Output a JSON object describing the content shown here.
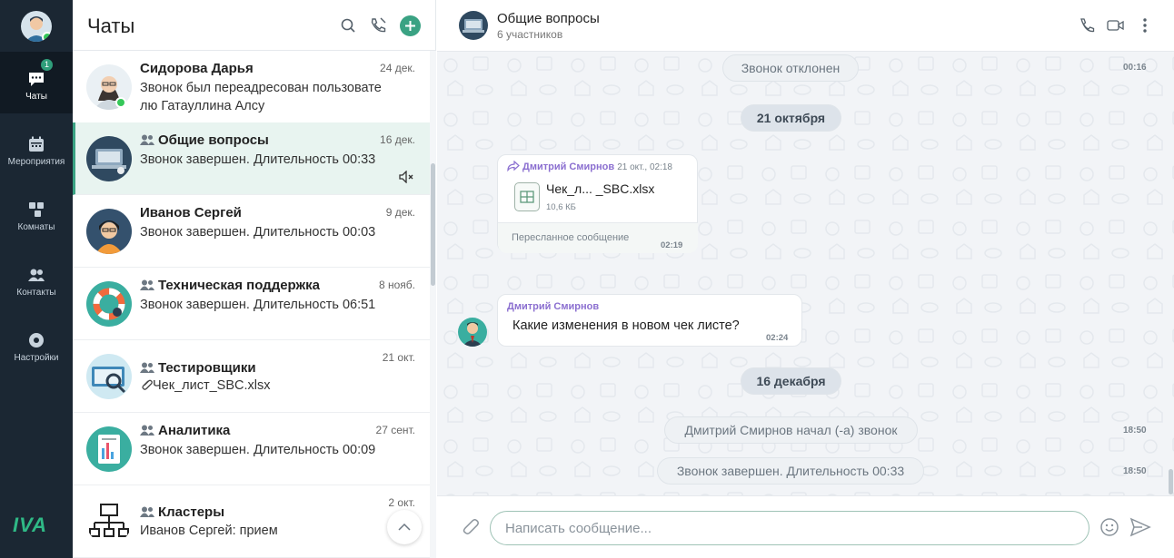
{
  "rail": {
    "items": [
      {
        "label": "Чаты",
        "badge": "1"
      },
      {
        "label": "Мероприятия"
      },
      {
        "label": "Комнаты"
      },
      {
        "label": "Контакты"
      },
      {
        "label": "Настройки"
      }
    ],
    "logo": "IVA"
  },
  "list": {
    "title": "Чаты",
    "chats": [
      {
        "name": "Сидорова Дарья",
        "date": "24 дек.",
        "preview": "Звонок был переадресован пользователю Гатауллина Алсу",
        "group": false,
        "online": true
      },
      {
        "name": "Общие вопросы",
        "date": "16 дек.",
        "preview": "Звонок завершен. Длительность 00:33",
        "group": true,
        "muted": true
      },
      {
        "name": "Иванов Сергей",
        "date": "9 дек.",
        "preview": "Звонок завершен. Длительность 00:03",
        "group": false
      },
      {
        "name": "Техническая поддержка",
        "date": "8 нояб.",
        "preview": "Звонок завершен. Длительность 06:51",
        "group": true
      },
      {
        "name": "Тестировщики",
        "date": "21 окт.",
        "preview": "Чек_лист_SBC.xlsx",
        "group": true
      },
      {
        "name": "Аналитика",
        "date": "27 сент.",
        "preview": "Звонок завершен. Длительность 00:09",
        "group": true
      },
      {
        "name": "Кластеры",
        "date": "2 окт.",
        "preview": "Иванов Сергей: прием",
        "group": true
      }
    ]
  },
  "conversation": {
    "title": "Общие вопросы",
    "subtitle": "6 участников",
    "messages": {
      "declined": {
        "text": "Звонок отклонен",
        "time": "00:16"
      },
      "date1": "21 октября",
      "forwarded": {
        "author": "Дмитрий Смирнов",
        "author_time": "21 окт., 02:18",
        "file_name": "Чек_л... _SBC.xlsx",
        "file_size": "10,6 КБ",
        "footer": "Пересланное сообщение",
        "time": "02:19"
      },
      "question": {
        "author": "Дмитрий Смирнов",
        "text": "Какие изменения в новом чек листе?",
        "time": "02:24"
      },
      "date2": "16 декабря",
      "call_started": {
        "text": "Дмитрий Смирнов начал (-а) звонок",
        "time": "18:50"
      },
      "call_ended": {
        "text": "Звонок завершен. Длительность 00:33",
        "time": "18:50"
      }
    },
    "composer": {
      "placeholder": "Написать сообщение..."
    }
  },
  "colors": {
    "accent": "#3aa283",
    "rail": "#1b2733",
    "author": "#8b6fd0"
  }
}
